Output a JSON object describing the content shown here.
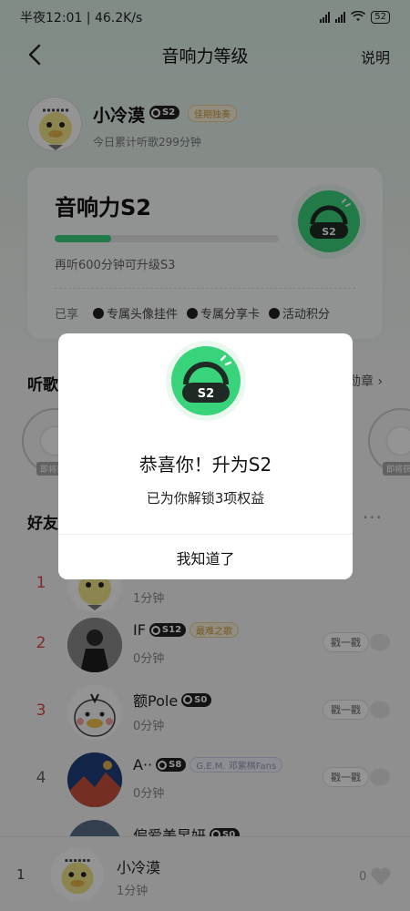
{
  "status_bar": {
    "time_speed": "半夜12:01 | 46.2K/s",
    "net1": "HD",
    "net2": "HD",
    "battery": "52"
  },
  "nav": {
    "title": "音响力等级",
    "help_label": "说明"
  },
  "profile": {
    "name": "小冷漠",
    "level_badge": "S2",
    "honor_tag": "佳期独奏",
    "today_listen": "今日累计听歌299分钟"
  },
  "level_card": {
    "title": "音响力S2",
    "progress": 0.25,
    "upgrade_hint": "再听600分钟可升级S3",
    "perks_label": "已享",
    "perks": [
      "专属头像挂件",
      "专属分享卡",
      "活动积分"
    ]
  },
  "listen_section": {
    "title": "听歌",
    "more_label": "勋章",
    "medal_tag": "即将获"
  },
  "friends_section": {
    "title": "好友",
    "more_icon": "···"
  },
  "ranking": [
    {
      "rank": "1",
      "name": "",
      "badge": "",
      "tag": "",
      "minutes": "1分钟",
      "poke": ""
    },
    {
      "rank": "2",
      "name": "IF",
      "badge": "S12",
      "tag": "最难之歌",
      "minutes": "0分钟",
      "poke": "戳一戳"
    },
    {
      "rank": "3",
      "name": "额Pole",
      "badge": "S0",
      "tag": "",
      "minutes": "0分钟",
      "poke": "戳一戳"
    },
    {
      "rank": "4",
      "name": "A··",
      "badge": "S8",
      "tag": "G.E.M. 邓紫棋Fans",
      "minutes": "0分钟",
      "poke": "戳一戳"
    },
    {
      "rank": "",
      "name": "偏爱美昱妍",
      "badge": "S0",
      "tag": "",
      "minutes": "",
      "poke": ""
    }
  ],
  "my_rank": {
    "rank": "1",
    "name": "小冷漠",
    "minutes": "1分钟",
    "likes": "0"
  },
  "dialog": {
    "badge_text": "S2",
    "title": "恭喜你！升为S2",
    "subtitle": "已为你解锁3项权益",
    "confirm_label": "我知道了"
  },
  "colors": {
    "accent": "#39d37b",
    "rank_red": "#e34848",
    "overlay": "rgba(0,0,0,0.42)"
  }
}
